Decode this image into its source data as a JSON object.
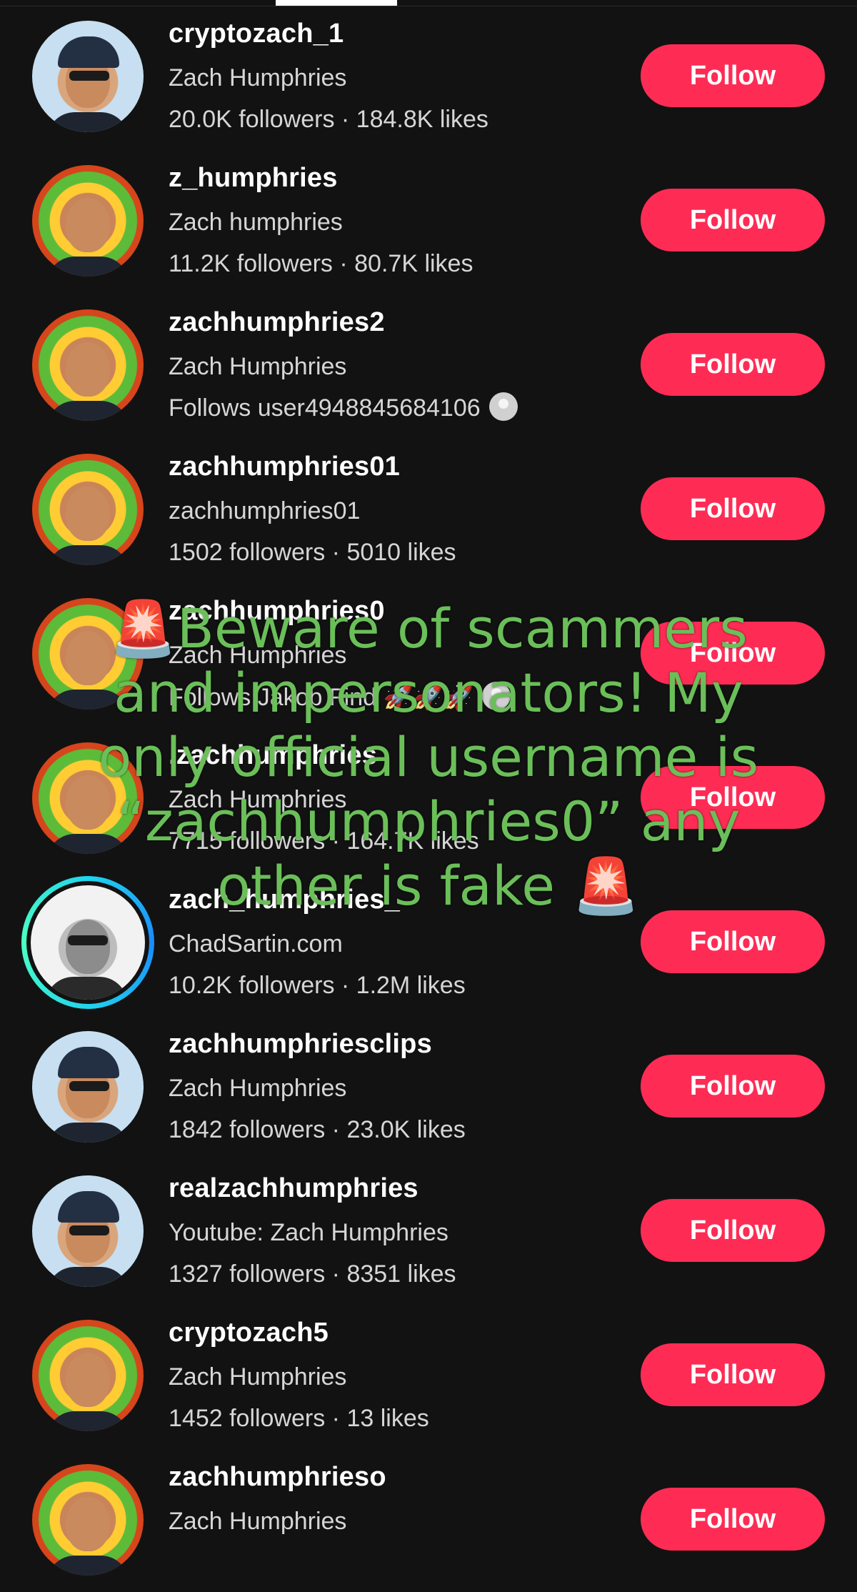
{
  "tab_indicator": "active-tab",
  "follow_label": "Follow",
  "accounts": [
    {
      "username": "cryptozach_1",
      "nickname": "Zach Humphries",
      "stats": "20.0K followers · 184.8K likes",
      "avatar": "cap"
    },
    {
      "username": "z_humphries",
      "nickname": "Zach humphries",
      "stats": "11.2K followers · 80.7K likes",
      "avatar": "green"
    },
    {
      "username": "zachhumphries2",
      "nickname": "Zach Humphries",
      "stats": "Follows user4948845684106",
      "avatar": "green",
      "stats_avatar": true
    },
    {
      "username": "zachhumphries01",
      "nickname": "zachhumphries01",
      "stats": "1502 followers · 5010 likes",
      "avatar": "green"
    },
    {
      "username": "zachhumphries0",
      "nickname": "Zach Humphries",
      "stats": "Follows Jakob Find 🚀🚀🚀",
      "avatar": "green",
      "stats_avatar": true
    },
    {
      "username": ".zachhumphries",
      "nickname": "Zach Humphries",
      "stats": "7715 followers · 164.7K likes",
      "avatar": "green"
    },
    {
      "username": "zach_humphries_",
      "nickname": "ChadSartin.com",
      "stats": "10.2K followers · 1.2M likes",
      "avatar": "bw",
      "ring": true
    },
    {
      "username": "zachhumphriesclips",
      "nickname": "Zach Humphries",
      "stats": "1842 followers · 23.0K likes",
      "avatar": "cap"
    },
    {
      "username": "realzachhumphries",
      "nickname": "Youtube: Zach Humphries",
      "stats": "1327 followers · 8351 likes",
      "avatar": "cap"
    },
    {
      "username": "cryptozach5",
      "nickname": "Zach Humphries",
      "stats": "1452 followers · 13 likes",
      "avatar": "green"
    },
    {
      "username": "zachhumphrieso",
      "nickname": "Zach Humphries",
      "stats": "",
      "avatar": "green"
    }
  ],
  "overlay": {
    "siren": "🚨",
    "text": "Beware of scammers and impersonators! My only official username is “zachhumphries0” any other is fake"
  },
  "colors": {
    "follow_button": "#fe2c55",
    "overlay_text": "#6bbf59",
    "background": "#121212"
  }
}
